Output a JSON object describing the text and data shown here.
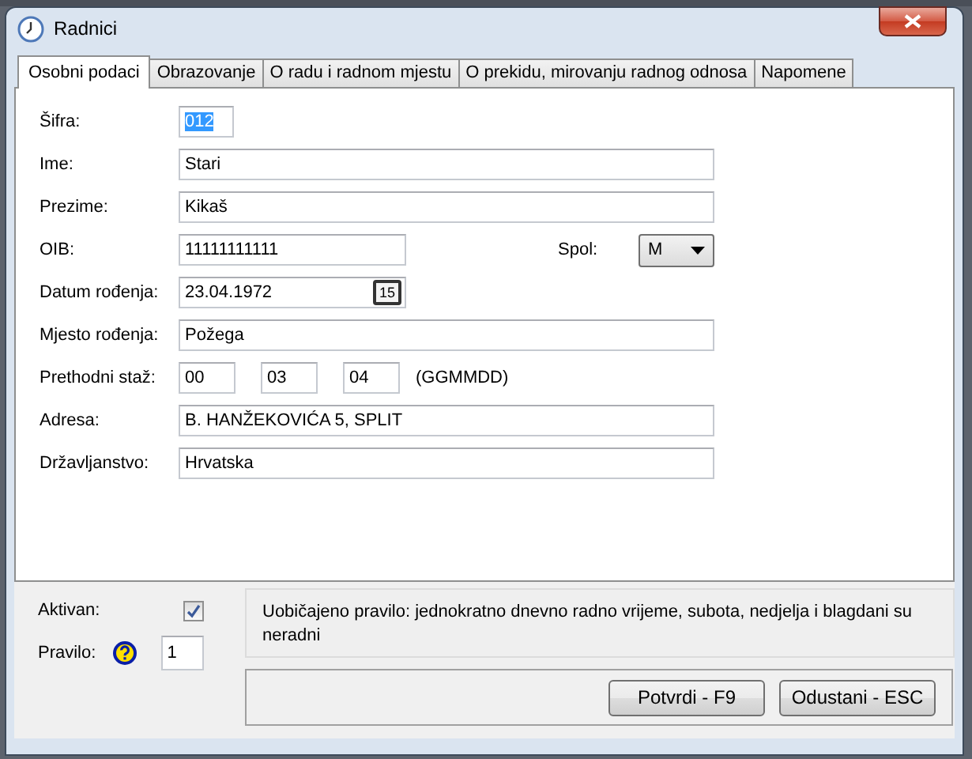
{
  "window": {
    "title": "Radnici"
  },
  "tabs": [
    {
      "label": "Osobni podaci",
      "selected": true
    },
    {
      "label": "Obrazovanje",
      "selected": false
    },
    {
      "label": "O radu i radnom mjestu",
      "selected": false
    },
    {
      "label": "O prekidu, mirovanju radnog odnosa",
      "selected": false
    },
    {
      "label": "Napomene",
      "selected": false
    }
  ],
  "fields": [
    {
      "kind": "code",
      "label": "Šifra:",
      "value": "012",
      "highlighted": true
    },
    {
      "kind": "text",
      "label": "Ime:",
      "value": "Stari",
      "highlighted": false
    },
    {
      "kind": "text",
      "label": "Prezime:",
      "value": "Kikaš",
      "highlighted": false
    },
    {
      "kind": "oib",
      "label": "OIB:",
      "value": "11111111111",
      "highlighted": false,
      "extra_label": "Spol:",
      "select_value": "M"
    },
    {
      "kind": "date",
      "label": "Datum rođenja:",
      "value": "23.04.1972",
      "highlighted": false,
      "button_text": "15"
    },
    {
      "kind": "text",
      "label": "Mjesto rođenja:",
      "value": "Požega",
      "highlighted": false
    },
    {
      "kind": "triple",
      "label": "Prethodni staž:",
      "values": [
        "00",
        "03",
        "04"
      ],
      "hint": "(GGMMDD)",
      "highlighted": false
    },
    {
      "kind": "text",
      "label": "Adresa:",
      "value": "B. HANŽEKOVIĆA 5, SPLIT",
      "highlighted": false
    },
    {
      "kind": "text",
      "label": "Državljanstvo:",
      "value": "Hrvatska",
      "highlighted": false
    }
  ],
  "aktivan": {
    "label": "Aktivan:",
    "checked": true
  },
  "pravilo": {
    "label": "Pravilo:",
    "value": "1",
    "description": "Uobičajeno pravilo: jednokratno dnevno radno vrijeme, subota, nedjelja i blagdani su neradni"
  },
  "buttons": [
    "Potvrdi - F9",
    "Odustani - ESC"
  ]
}
